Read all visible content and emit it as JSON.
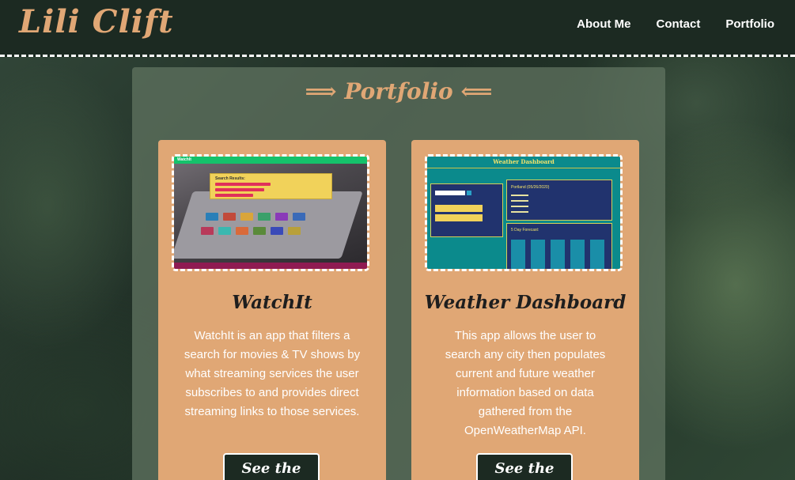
{
  "header": {
    "logo": "Lili Clift",
    "nav": [
      "About Me",
      "Contact",
      "Portfolio"
    ]
  },
  "portfolio": {
    "title": "⟹ Portfolio ⟸",
    "projects": [
      {
        "title": "WatchIt",
        "description": "WatchIt is an app that filters a search for movies & TV shows by what streaming services the user subscribes to and provides direct streaming links to those services.",
        "button": "See the Page",
        "thumbnail": {
          "app_name": "WatchIt",
          "panel_heading": "Search Results:"
        }
      },
      {
        "title": "Weather Dashboard",
        "description": "This app allows the user to search any city then populates current and future weather information based on data gathered from the OpenWeatherMap API.",
        "button": "See the Page",
        "thumbnail": {
          "heading": "Weather Dashboard",
          "city_line": "Portland (05/26/2020)",
          "forecast_heading": "5 Day Forecast:"
        }
      }
    ]
  },
  "colors": {
    "accent": "#e0a775",
    "header_bg": "#1c2a22",
    "panel_bg": "#627662"
  }
}
